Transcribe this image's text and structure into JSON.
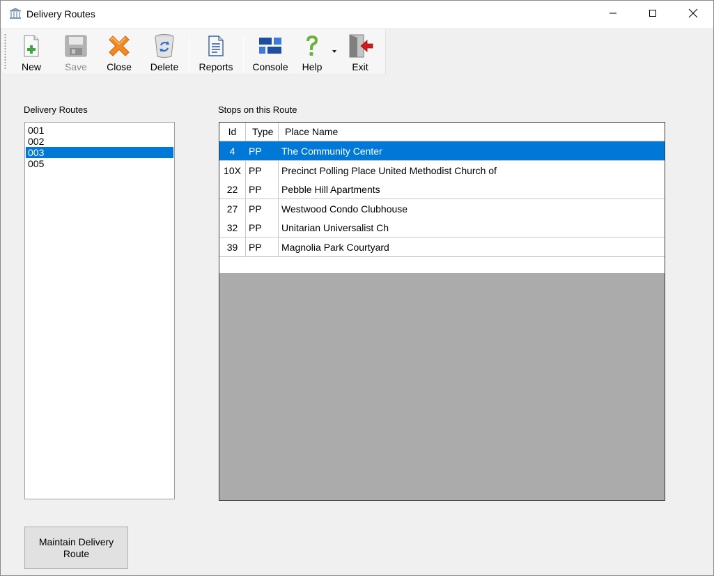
{
  "window": {
    "title": "Delivery Routes",
    "icon": "bank-building-icon"
  },
  "toolbar": {
    "items": [
      {
        "label": "New",
        "icon": "new-document-icon",
        "enabled": true
      },
      {
        "label": "Save",
        "icon": "floppy-disk-icon",
        "enabled": false
      },
      {
        "label": "Close",
        "icon": "orange-x-icon",
        "enabled": true
      },
      {
        "label": "Delete",
        "icon": "recycle-bin-icon",
        "enabled": true
      },
      {
        "label": "Reports",
        "icon": "report-document-icon",
        "enabled": true
      },
      {
        "label": "Console",
        "icon": "console-blocks-icon",
        "enabled": true
      },
      {
        "label": "Help",
        "icon": "question-mark-icon",
        "enabled": true
      },
      {
        "label": "Exit",
        "icon": "exit-door-icon",
        "enabled": true
      }
    ]
  },
  "routes": {
    "label": "Delivery Routes",
    "items": [
      "001",
      "002",
      "003",
      "005"
    ],
    "selected": "003"
  },
  "stops": {
    "label": "Stops on this Route",
    "columns": [
      "Id",
      "Type",
      "Place Name"
    ],
    "rows": [
      {
        "id": "4",
        "type": "PP",
        "name": "The Community Center",
        "selected": true
      },
      {
        "id": "10X",
        "type": "PP",
        "name": "Precinct Polling Place United Methodist Church of",
        "selected": false
      },
      {
        "id": "22",
        "type": "PP",
        "name": "Pebble Hill Apartments",
        "selected": false
      },
      {
        "id": "27",
        "type": "PP",
        "name": "Westwood Condo Clubhouse",
        "selected": false
      },
      {
        "id": "32",
        "type": "PP",
        "name": "Unitarian Universalist Ch",
        "selected": false
      },
      {
        "id": "39",
        "type": "PP",
        "name": "Magnolia Park Courtyard",
        "selected": false
      }
    ]
  },
  "actions": {
    "maintain_label": "Maintain Delivery Route"
  },
  "colors": {
    "selection": "#0078d7",
    "window_bg": "#f0f0f0",
    "exit_arrow": "#d11a1a",
    "help_green": "#6cb33e",
    "console_blue": "#1f4e9c"
  }
}
